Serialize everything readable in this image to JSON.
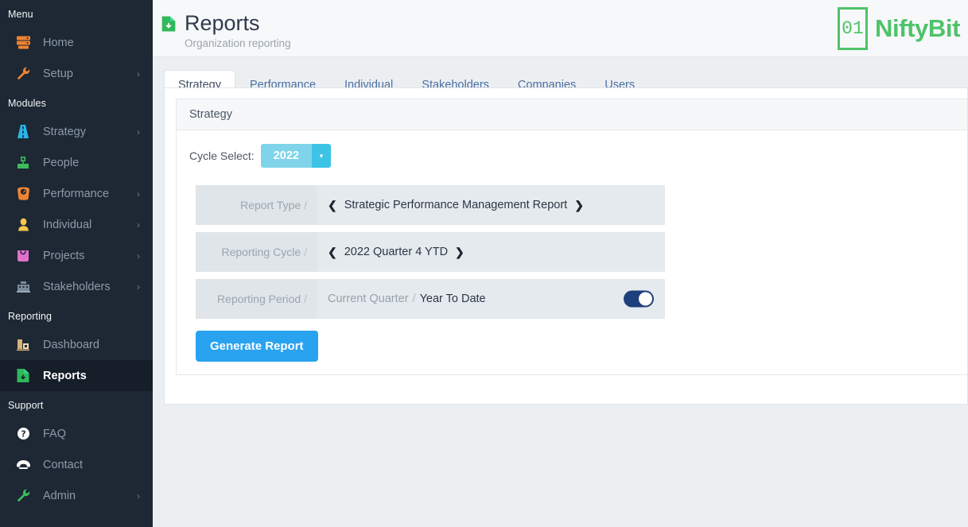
{
  "sidebar": {
    "sections": [
      {
        "title": "Menu",
        "items": [
          {
            "label": "Home",
            "icon": "server-stack-icon",
            "chevron": "",
            "active": false
          },
          {
            "label": "Setup",
            "icon": "wrench-icon",
            "chevron": "›",
            "active": false
          }
        ]
      },
      {
        "title": "Modules",
        "items": [
          {
            "label": "Strategy",
            "icon": "road-icon",
            "chevron": "›",
            "active": false
          },
          {
            "label": "People",
            "icon": "people-icon",
            "chevron": "",
            "active": false
          },
          {
            "label": "Performance",
            "icon": "gauge-icon",
            "chevron": "›",
            "active": false
          },
          {
            "label": "Individual",
            "icon": "person-icon",
            "chevron": "›",
            "active": false
          },
          {
            "label": "Projects",
            "icon": "briefcase-icon",
            "chevron": "›",
            "active": false
          },
          {
            "label": "Stakeholders",
            "icon": "building-icon",
            "chevron": "›",
            "active": false
          }
        ]
      },
      {
        "title": "Reporting",
        "items": [
          {
            "label": "Dashboard",
            "icon": "bar-chart-icon",
            "chevron": "",
            "active": false
          },
          {
            "label": "Reports",
            "icon": "report-document-icon",
            "chevron": "",
            "active": true
          }
        ]
      },
      {
        "title": "Support",
        "items": [
          {
            "label": "FAQ",
            "icon": "question-circle-icon",
            "chevron": "",
            "active": false
          },
          {
            "label": "Contact",
            "icon": "telephone-icon",
            "chevron": "",
            "active": false
          },
          {
            "label": "Admin",
            "icon": "wrench-green-icon",
            "chevron": "›",
            "active": false
          }
        ]
      }
    ]
  },
  "header": {
    "title": "Reports",
    "subtitle": "Organization reporting",
    "icon": "report-document-icon",
    "brand": {
      "mark": "01",
      "name": "NiftyBit",
      "color": "#4ec36a"
    }
  },
  "tabs": [
    {
      "label": "Strategy",
      "active": true
    },
    {
      "label": "Performance",
      "active": false
    },
    {
      "label": "Individual",
      "active": false
    },
    {
      "label": "Stakeholders",
      "active": false
    },
    {
      "label": "Companies",
      "active": false
    },
    {
      "label": "Users",
      "active": false
    }
  ],
  "card": {
    "title": "Strategy",
    "cycle_select": {
      "label": "Cycle Select:",
      "value": "2022",
      "caret": "▾"
    },
    "fields": [
      {
        "key": "Report Type",
        "slash": "/",
        "prev_arrow": "❮",
        "value": "Strategic Performance Management Report",
        "next_arrow": "❯",
        "toggle": null
      },
      {
        "key": "Reporting Cycle",
        "slash": "/",
        "prev_arrow": "❮",
        "value": "2022 Quarter 4 YTD",
        "next_arrow": "❯",
        "toggle": null
      }
    ],
    "period_row": {
      "key": "Reporting Period",
      "slash": "/",
      "option_off": "Current Quarter",
      "separator": "/",
      "option_on": "Year To Date",
      "toggle_state": "on"
    },
    "generate_button": "Generate Report"
  },
  "colors": {
    "sidebar_bg": "#1d2834",
    "accent_blue": "#29a3f0",
    "dropdown_light": "#7fd4ea",
    "dropdown_dark": "#3cc3e5",
    "toggle_on": "#1d3f7c",
    "brand_green": "#4ec36a"
  }
}
